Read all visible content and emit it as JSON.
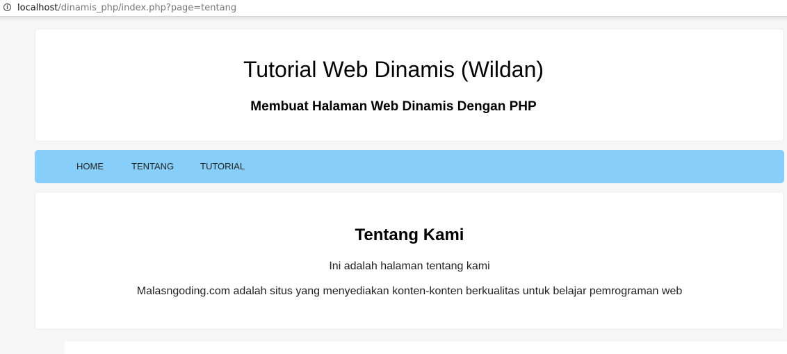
{
  "browser": {
    "url_host": "localhost",
    "url_path": "/dinamis_php/index.php?page=tentang",
    "info_icon": "info-icon"
  },
  "header": {
    "title": "Tutorial Web Dinamis (Wildan)",
    "subtitle": "Membuat Halaman Web Dinamis Dengan PHP"
  },
  "nav": {
    "items": [
      {
        "label": "HOME"
      },
      {
        "label": "TENTANG"
      },
      {
        "label": "TUTORIAL"
      }
    ],
    "background": "#87cefa"
  },
  "content": {
    "title": "Tentang Kami",
    "paragraphs": [
      "Ini adalah halaman tentang kami",
      "Malasngoding.com adalah situs yang menyediakan konten-konten berkualitas untuk belajar pemrograman web"
    ]
  }
}
